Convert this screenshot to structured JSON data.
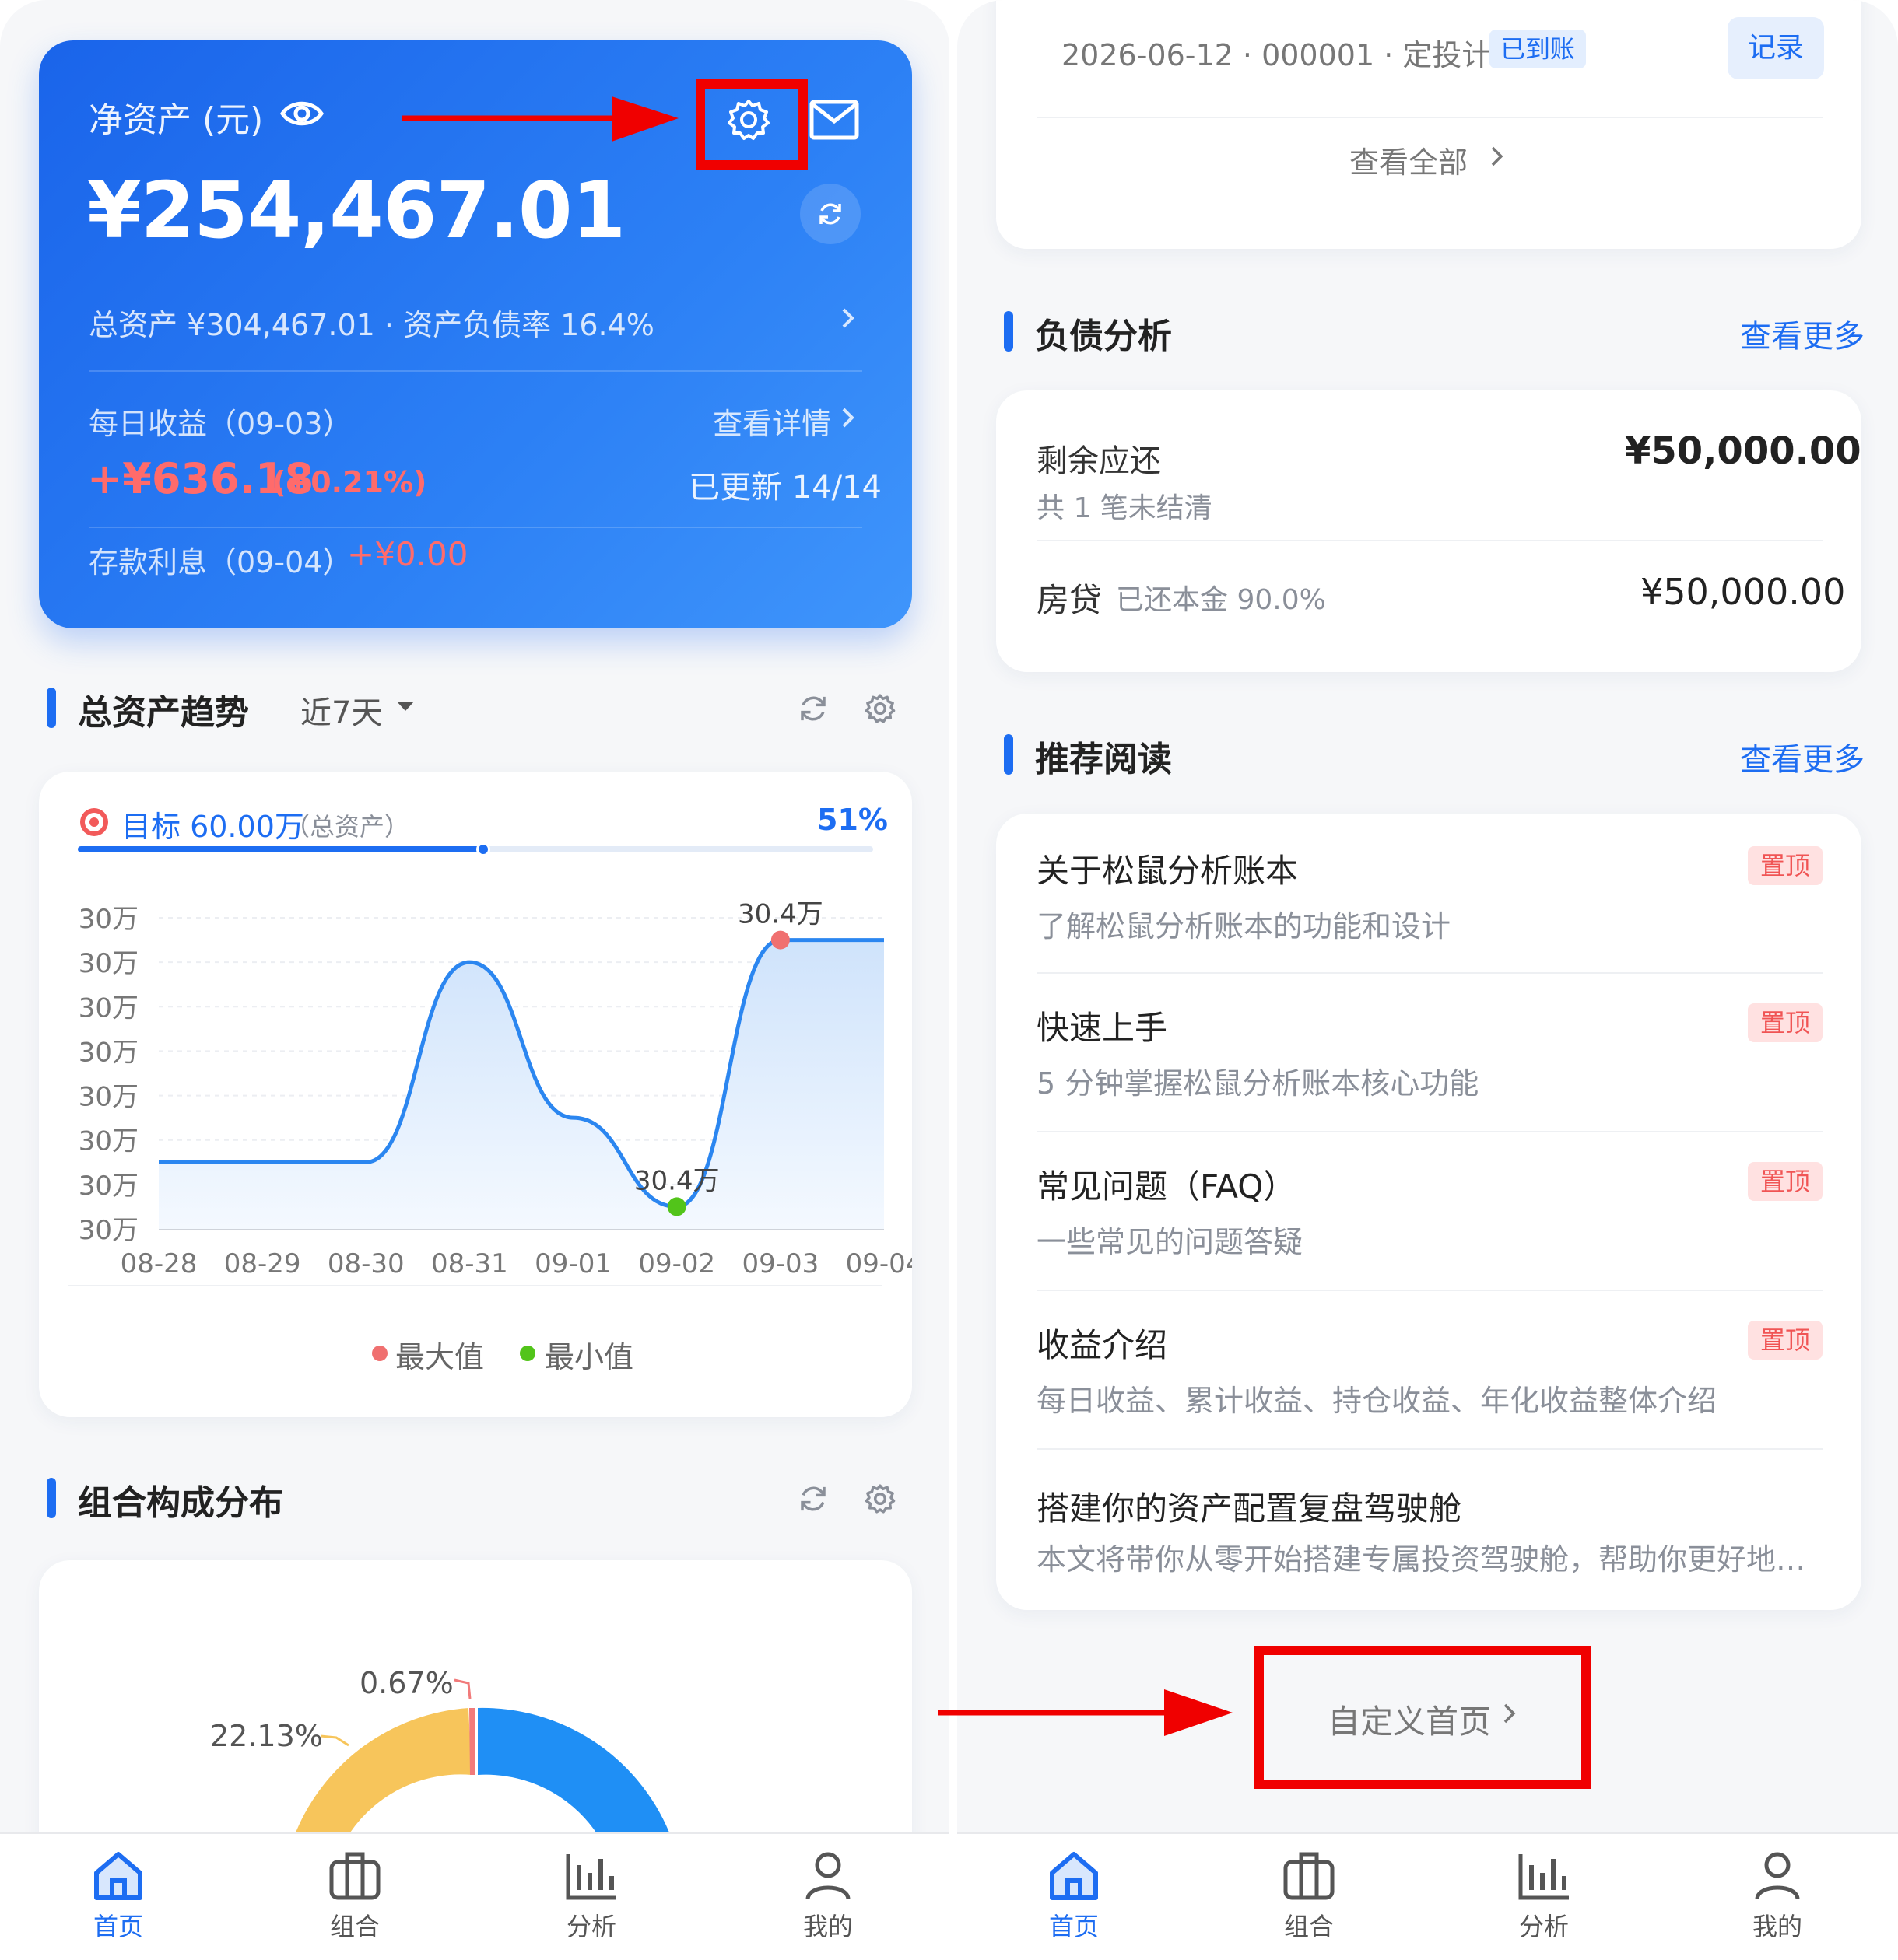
{
  "colors": {
    "accent": "#1d6df2",
    "positive": "#ff6b6b",
    "annotation": "#f00000",
    "max_dot": "#f07070",
    "min_dot": "#52c41a"
  },
  "left": {
    "hero": {
      "title": "净资产 (元)",
      "net_value": "¥254,467.01",
      "summary": "总资产 ¥304,467.01 · 资产负债率 16.4%",
      "daily_label": "每日收益（09-03）",
      "details_link": "查看详情",
      "daily_value": "+¥636.18",
      "daily_pct": "(+0.21%)",
      "updated": "已更新 14/14",
      "interest_label": "存款利息（09-04）",
      "interest_value": "+¥0.00",
      "icons": [
        "eye-icon",
        "gear-icon",
        "mail-icon",
        "refresh-icon",
        "chevron-right-icon"
      ]
    },
    "trend": {
      "title": "总资产趋势",
      "range": "近7天",
      "goal_label": "目标 60.00万",
      "goal_sub": "（总资产）",
      "goal_pct": "51%",
      "goal_progress": 0.51,
      "legend_max": "最大值",
      "legend_min": "最小值"
    },
    "composition": {
      "title": "组合构成分布"
    }
  },
  "chart_data": {
    "type": "area",
    "x": [
      "08-28",
      "08-29",
      "08-30",
      "08-31",
      "09-01",
      "09-02",
      "09-03",
      "09-04"
    ],
    "y_tick_labels": [
      "30万",
      "30万",
      "30万",
      "30万",
      "30万",
      "30万",
      "30万",
      "30万"
    ],
    "series": [
      {
        "values": [
          30.38,
          30.38,
          30.38,
          30.47,
          30.4,
          30.36,
          30.48,
          30.48
        ]
      }
    ],
    "annotations": [
      {
        "x": "09-03",
        "label": "30.4万",
        "kind": "max"
      },
      {
        "x": "09-02",
        "label": "30.4万",
        "kind": "min"
      }
    ],
    "legend": [
      "最大值",
      "最小值"
    ],
    "grid": true,
    "legend_position": "bottom"
  },
  "donut": {
    "labels": [
      "0.67%",
      "22.13%"
    ],
    "colors": [
      "#f7c55b",
      "#1f8ff5"
    ]
  },
  "right": {
    "record": {
      "text": "2026-06-12 · 000001 · 定投计划",
      "badge": "已到账",
      "button": "记录",
      "view_all": "查看全部"
    },
    "debt": {
      "title": "负债分析",
      "more": "查看更多",
      "remaining_label": "剩余应还",
      "remaining_value": "¥50,000.00",
      "remaining_sub": "共 1 笔未结清",
      "loan_label": "房贷",
      "loan_sub": "已还本金 90.0%",
      "loan_value": "¥50,000.00"
    },
    "reading": {
      "title": "推荐阅读",
      "more": "查看更多",
      "items": [
        {
          "title": "关于松鼠分析账本",
          "sub": "了解松鼠分析账本的功能和设计",
          "tag": "置顶"
        },
        {
          "title": "快速上手",
          "sub": "5 分钟掌握松鼠分析账本核心功能",
          "tag": "置顶"
        },
        {
          "title": "常见问题（FAQ）",
          "sub": "一些常见的问题答疑",
          "tag": "置顶"
        },
        {
          "title": "收益介绍",
          "sub": "每日收益、累计收益、持仓收益、年化收益整体介绍",
          "tag": "置顶"
        },
        {
          "title": "搭建你的资产配置复盘驾驶舱",
          "sub": "本文将带你从零开始搭建专属投资驾驶舱，帮助你更好地…",
          "tag": ""
        }
      ]
    },
    "customize": "自定义首页"
  },
  "tabs": [
    {
      "label": "首页",
      "icon": "home-icon",
      "active": true
    },
    {
      "label": "组合",
      "icon": "briefcase-icon",
      "active": false
    },
    {
      "label": "分析",
      "icon": "bar-chart-icon",
      "active": false
    },
    {
      "label": "我的",
      "icon": "user-icon",
      "active": false
    }
  ]
}
